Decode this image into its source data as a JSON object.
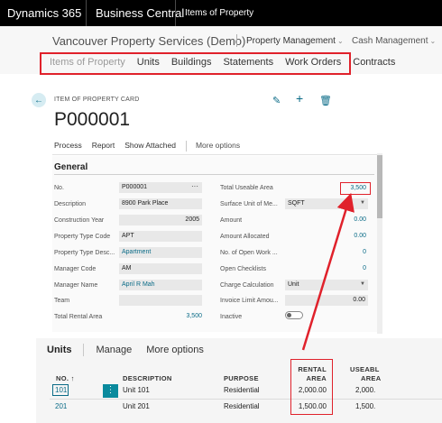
{
  "topbar": {
    "product": "Dynamics 365",
    "app": "Business Central",
    "page": "Items of Property"
  },
  "company": {
    "name": "Vancouver Property Services (Demo)",
    "role_center": "Property Management",
    "cash": "Cash Management"
  },
  "nav": {
    "items": [
      "Items of Property",
      "Units",
      "Buildings",
      "Statements",
      "Work Orders",
      "Contracts"
    ]
  },
  "card": {
    "caption": "ITEM OF PROPERTY CARD",
    "title": "P000001",
    "actions": {
      "process": "Process",
      "report": "Report",
      "show_attached": "Show Attached",
      "more": "More options"
    },
    "general": {
      "title": "General",
      "left": [
        {
          "label": "No.",
          "value": "P000001"
        },
        {
          "label": "Description",
          "value": "8900 Park Place"
        },
        {
          "label": "Construction Year",
          "value": "2005"
        },
        {
          "label": "Property Type Code",
          "value": "APT"
        },
        {
          "label": "Property Type Desc...",
          "value": "Apartment"
        },
        {
          "label": "Manager Code",
          "value": "AM"
        },
        {
          "label": "Manager Name",
          "value": "April R Mah"
        },
        {
          "label": "Team",
          "value": ""
        },
        {
          "label": "Total Rental Area",
          "value": "3,500"
        }
      ],
      "right": [
        {
          "label": "Total Useable Area",
          "value": "3,500"
        },
        {
          "label": "Surface Unit of Me...",
          "value": "SQFT"
        },
        {
          "label": "Amount",
          "value": "0.00"
        },
        {
          "label": "Amount Allocated",
          "value": "0.00"
        },
        {
          "label": "No. of Open Work ...",
          "value": "0"
        },
        {
          "label": "Open Checklists",
          "value": "0"
        },
        {
          "label": "Charge Calculation",
          "value": "Unit"
        },
        {
          "label": "Invoice Limit Amou...",
          "value": "0.00"
        },
        {
          "label": "Inactive",
          "value": ""
        }
      ]
    }
  },
  "units": {
    "title": "Units",
    "manage": "Manage",
    "more": "More options",
    "columns": {
      "no": "NO. ↑",
      "description": "DESCRIPTION",
      "purpose": "PURPOSE",
      "rental_area_1": "RENTAL",
      "rental_area_2": "AREA",
      "useable_1": "USEABL",
      "useable_2": "AREA"
    },
    "rows": [
      {
        "no": "101",
        "description": "Unit 101",
        "purpose": "Residential",
        "rental_area": "2,000.00",
        "useable_area": "2,000."
      },
      {
        "no": "201",
        "description": "Unit 201",
        "purpose": "Residential",
        "rental_area": "1,500.00",
        "useable_area": "1,500."
      }
    ]
  },
  "colors": {
    "accent": "#0a6b87",
    "highlight": "#e0212b",
    "topbar": "#000000"
  }
}
